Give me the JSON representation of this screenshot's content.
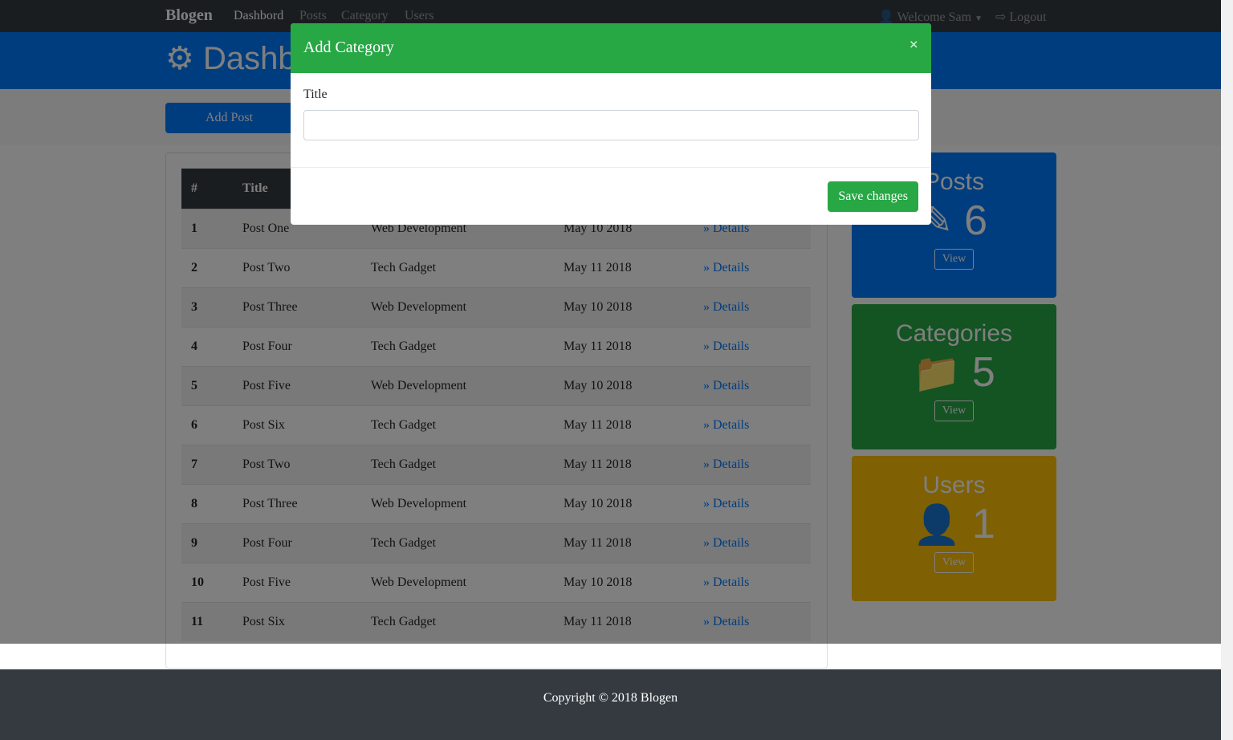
{
  "nav": {
    "brand": "Blogen",
    "links": [
      "Dashbord",
      "Posts",
      "Category",
      "Users"
    ],
    "user": "Welcome Sam",
    "logout": "Logout"
  },
  "header": {
    "title": "Dashboard"
  },
  "actions": {
    "add_post": "Add Post"
  },
  "table": {
    "headers": [
      "#",
      "Title"
    ],
    "rows": [
      [
        "1",
        "Post One",
        "Web Development",
        "May 10 2018",
        "Details"
      ],
      [
        "2",
        "Post Two",
        "Tech Gadget",
        "May 11 2018",
        "Details"
      ],
      [
        "3",
        "Post Three",
        "Web Development",
        "May 10 2018",
        "Details"
      ],
      [
        "4",
        "Post Four",
        "Tech Gadget",
        "May 11 2018",
        "Details"
      ],
      [
        "5",
        "Post Five",
        "Web Development",
        "May 10 2018",
        "Details"
      ],
      [
        "6",
        "Post Six",
        "Tech Gadget",
        "May 11 2018",
        "Details"
      ],
      [
        "7",
        "Post Two",
        "Tech Gadget",
        "May 11 2018",
        "Details"
      ],
      [
        "8",
        "Post Three",
        "Web Development",
        "May 10 2018",
        "Details"
      ],
      [
        "9",
        "Post Four",
        "Tech Gadget",
        "May 11 2018",
        "Details"
      ],
      [
        "10",
        "Post Five",
        "Web Development",
        "May 10 2018",
        "Details"
      ],
      [
        "11",
        "Post Six",
        "Tech Gadget",
        "May 11 2018",
        "Details"
      ]
    ]
  },
  "stats": [
    {
      "title": "Posts",
      "count": "6",
      "view": "View",
      "color": "#007bff"
    },
    {
      "title": "Categories",
      "count": "5",
      "view": "View",
      "color": "#28a745"
    },
    {
      "title": "Users",
      "count": "1",
      "view": "View",
      "color": "#ffc107"
    }
  ],
  "footer": {
    "text": "Copyright © 2018 Blogen"
  },
  "modal": {
    "title": "Add Category",
    "close": "×",
    "field_label": "Title",
    "field_value": "",
    "save": "Save changes"
  }
}
